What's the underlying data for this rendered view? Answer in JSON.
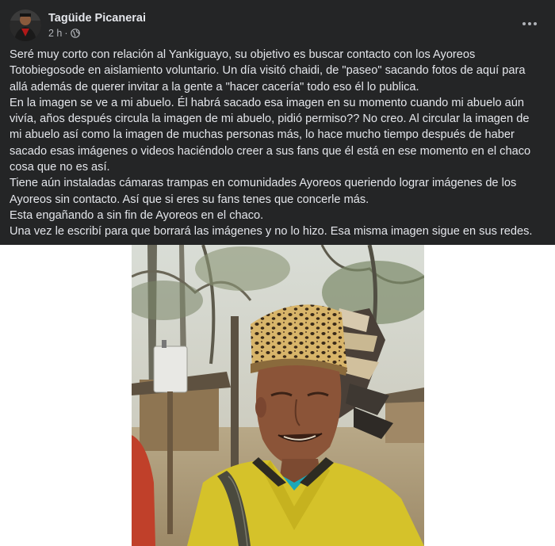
{
  "post": {
    "author": "Tagüide Picanerai",
    "time": "2 h",
    "separator": "·",
    "icons": {
      "avatar": "profile-avatar",
      "privacy": "globe-icon",
      "more": "more-options-icon"
    },
    "lines": [
      "Seré muy corto con relación al Yankiguayo, su objetivo es buscar contacto con los Ayoreos",
      "Totobiegosode en aislamiento voluntario. Un día visitó chaidi, de \"paseo\" sacando fotos de aquí para",
      "allá además de querer invitar a la gente a \"hacer cacería\" todo eso él lo publica.",
      "En la imagen se ve a mi abuelo. Él habrá sacado esa imagen en su momento cuando mi abuelo aún",
      "vivía, años después circula la imagen de mi abuelo, pidió permiso?? No creo. Al circular la imagen de",
      "mi abuelo así como la imagen de muchas personas más, lo hace mucho tiempo después de haber",
      "sacado esas imágenes o videos haciéndolo creer a sus fans que él está en ese momento en el chaco",
      "cosa que no es así.",
      "Tiene aún instaladas cámaras trampas en comunidades Ayoreos queriendo lograr imágenes de los",
      "Ayoreos sin contacto. Así que si eres su fans tenes que concerle más.",
      "Esta engañando a sin fin de Ayoreos en el chaco.",
      "Una vez le escribí para que borrará las imágenes y no lo hizo. Esa misma imagen sigue en sus redes."
    ]
  }
}
